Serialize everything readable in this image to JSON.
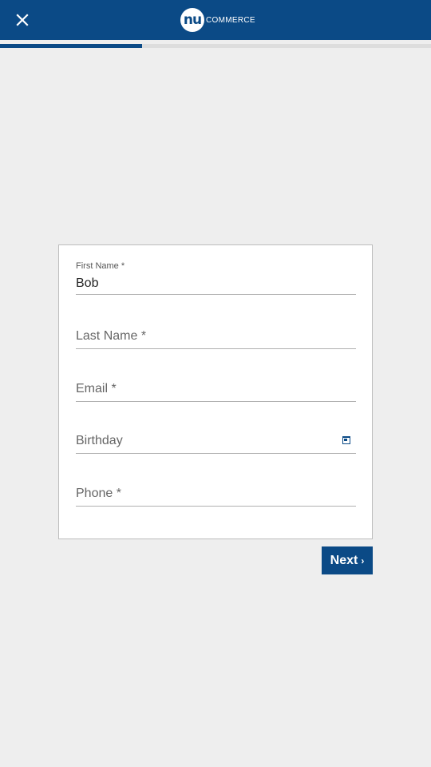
{
  "header": {
    "close_icon": "close-icon",
    "logo_badge": "nu",
    "logo_text": "COMMERCE",
    "brand_color": "#0b4a86"
  },
  "progress": {
    "fraction": 0.33
  },
  "form": {
    "first_name": {
      "label": "First Name *",
      "value": "Bob"
    },
    "last_name": {
      "label": "Last Name *",
      "value": ""
    },
    "email": {
      "label": "Email *",
      "value": ""
    },
    "birthday": {
      "label": "Birthday",
      "value": "",
      "icon": "calendar-icon"
    },
    "phone": {
      "label": "Phone *",
      "value": ""
    }
  },
  "actions": {
    "next_label": "Next",
    "next_icon": "chevron-right-icon"
  }
}
